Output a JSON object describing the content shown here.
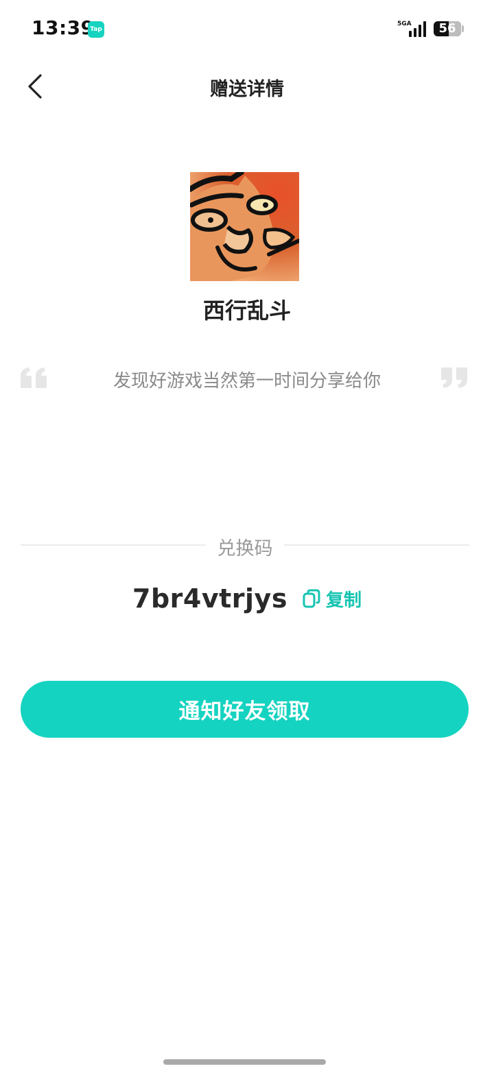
{
  "status_bar": {
    "time": "13:39",
    "app_badge": "Tap",
    "network": "5GA",
    "battery": "56",
    "battery_level": 0.56
  },
  "header": {
    "title": "赠送详情",
    "back_icon": "chevron-left-icon"
  },
  "game": {
    "name": "西行乱斗",
    "icon": "game-cover-image"
  },
  "message": {
    "text": "发现好游戏当然第一时间分享给你",
    "quote_icons": [
      "open-quote-icon",
      "close-quote-icon"
    ]
  },
  "redeem": {
    "label": "兑换码",
    "code": "7br4vtrjys",
    "copy_label": "复制",
    "copy_icon": "copy-icon"
  },
  "action": {
    "notify_label": "通知好友领取"
  },
  "colors": {
    "accent": "#14d3c0",
    "title_text": "#222222",
    "muted_text": "#8a8a8a"
  }
}
